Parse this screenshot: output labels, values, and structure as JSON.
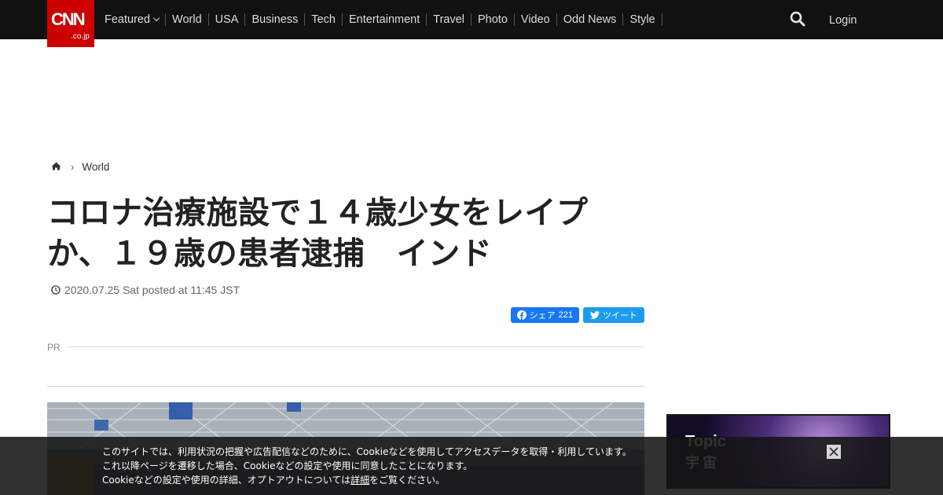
{
  "header": {
    "logo_main": "CNN",
    "logo_sub": ".co.jp",
    "nav": [
      "Featured",
      "World",
      "USA",
      "Business",
      "Tech",
      "Entertainment",
      "Travel",
      "Photo",
      "Video",
      "Odd News",
      "Style"
    ],
    "login": "Login"
  },
  "breadcrumb": {
    "home_icon": "home-icon",
    "section": "World"
  },
  "article": {
    "title_line1": "コロナ治療施設で１４歳少女をレイプ",
    "title_line2": "か、１９歳の患者逮捕　インド",
    "date": "2020.07.25 Sat posted at 11:45 JST"
  },
  "share": {
    "facebook_label": "シェア",
    "facebook_count": "221",
    "twitter_label": "ツイート"
  },
  "pr_label": "PR",
  "side_banner": {
    "line1": "Topic",
    "line2": "宇宙"
  },
  "cookie": {
    "line1": "このサイトでは、利用状況の把握や広告配信などのために、Cookieなどを使用してアクセスデータを取得・利用しています。",
    "line2": "これ以降ページを遷移した場合、Cookieなどの設定や使用に同意したことになります。",
    "line3_before": "Cookieなどの設定や使用の詳細、オプトアウトについては",
    "line3_link": "詳細",
    "line3_after": "をご覧ください。"
  },
  "colors": {
    "topbar": "#111111",
    "logo_red": "#cc0000",
    "facebook": "#1877f2",
    "twitter": "#1d9bf0"
  }
}
